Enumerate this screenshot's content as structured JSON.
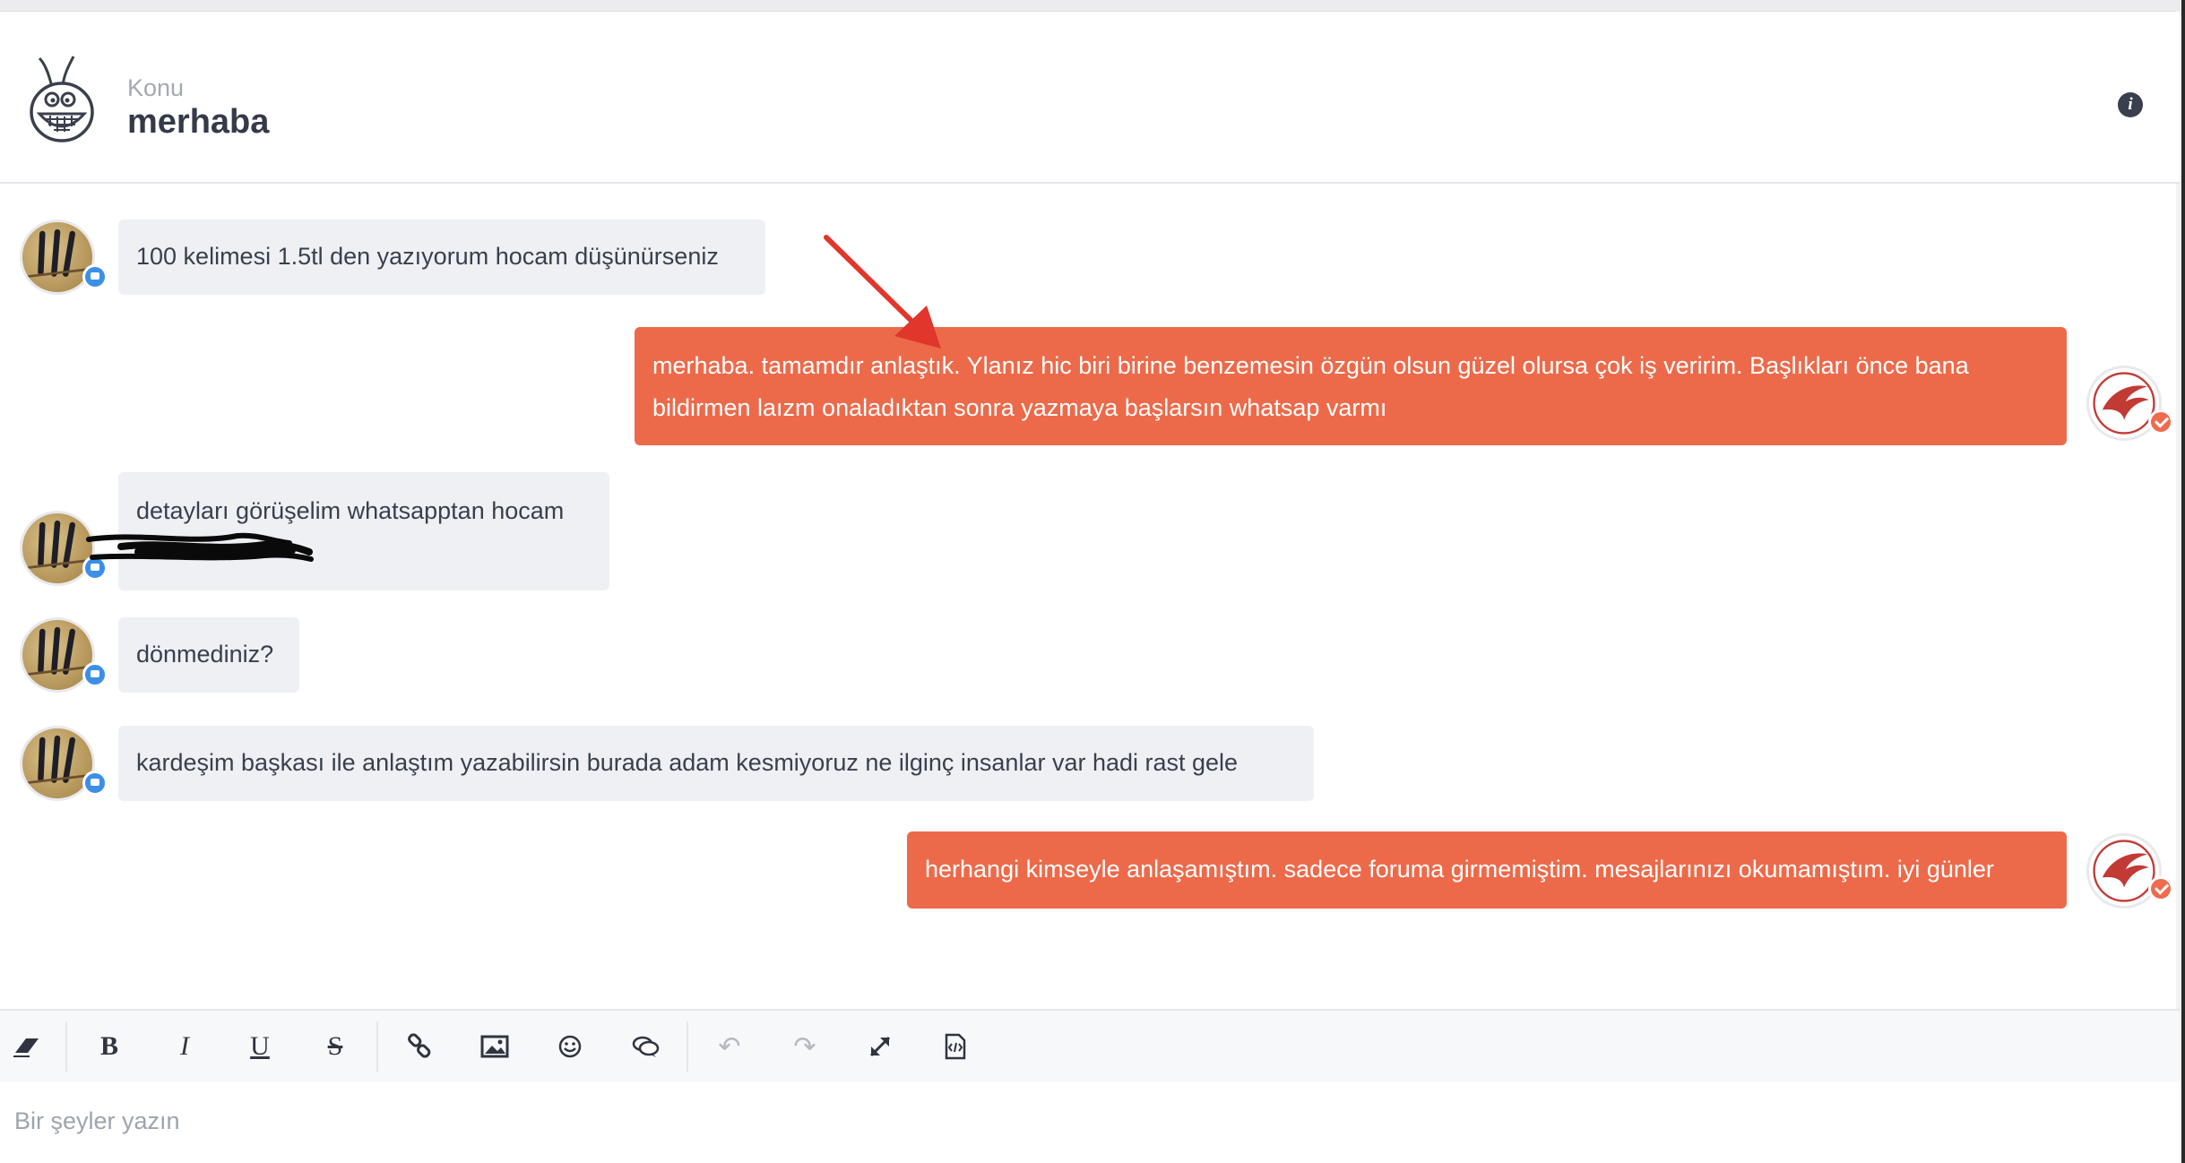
{
  "header": {
    "topic_label": "Konu",
    "topic_title": "merhaba",
    "logo_icon": "grinning-mascot-logo",
    "info_icon": "info-icon"
  },
  "messages": [
    {
      "direction": "incoming",
      "text": "100 kelimesi 1.5tl den yazıyorum hocam düşünürseniz"
    },
    {
      "direction": "outgoing",
      "lines": [
        "merhaba. tamamdır anlaştık. Ylanız hic biri birine benzemesin özgün olsun güzel olursa çok iş veririm. Başlıkları önce bana",
        "bildirmen laızm onaladıktan sonra yazmaya başlarsın whatsap varmı"
      ]
    },
    {
      "direction": "incoming",
      "text": "detayları görüşelim whatsapptan hocam",
      "redacted_second_line": true
    },
    {
      "direction": "incoming",
      "text": "dönmediniz?"
    },
    {
      "direction": "incoming",
      "text": "kardeşim başkası ile anlaştım yazabilirsin burada adam kesmiyoruz ne ilginç insanlar var hadi rast gele"
    },
    {
      "direction": "outgoing",
      "text": "herhangi kimseyle anlaşamıştım. sadece foruma girmemiştim. mesajlarınızı okumamıştım. iyi günler"
    }
  ],
  "toolbar": {
    "eraser": "⌫",
    "bold": "B",
    "italic": "I",
    "underline": "U",
    "strike": "S",
    "link": "🔗",
    "image": "▣",
    "emoji": "☺",
    "quote": "💬",
    "undo": "↶",
    "redo": "↷",
    "fullscreen": "⤢",
    "source": "</>"
  },
  "composer": {
    "placeholder": "Bir şeyler yazın",
    "value": ""
  },
  "colors": {
    "outgoing_bubble": "#ec6a4a",
    "incoming_bubble": "#eef0f4",
    "user_badge": "#3b8fe8",
    "admin_badge": "#ef6b4e",
    "annotation_arrow": "#e0362c"
  }
}
